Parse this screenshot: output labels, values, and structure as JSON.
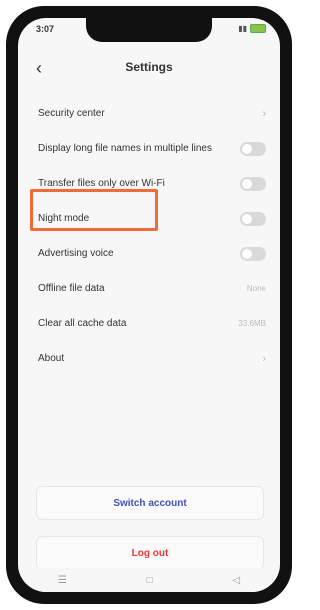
{
  "status_bar": {
    "time": "3:07"
  },
  "header": {
    "title": "Settings"
  },
  "settings": {
    "security_center": {
      "label": "Security center"
    },
    "long_names": {
      "label": "Display long file names in multiple lines"
    },
    "wifi_only": {
      "label": "Transfer files only over Wi-Fi"
    },
    "night_mode": {
      "label": "Night mode"
    },
    "ad_voice": {
      "label": "Advertising voice"
    },
    "offline_data": {
      "label": "Offline file data",
      "value": "None"
    },
    "clear_cache": {
      "label": "Clear all cache data",
      "value": "33.6MB"
    },
    "about": {
      "label": "About"
    }
  },
  "buttons": {
    "switch_account": "Switch account",
    "log_out": "Log out"
  },
  "colors": {
    "highlight": "#f06a3a",
    "switch_text": "#3f52b5",
    "logout_text": "#e53935"
  },
  "icons": [
    "back-icon",
    "chevron-right-icon",
    "menu-nav-icon",
    "home-nav-icon",
    "back-nav-icon"
  ]
}
